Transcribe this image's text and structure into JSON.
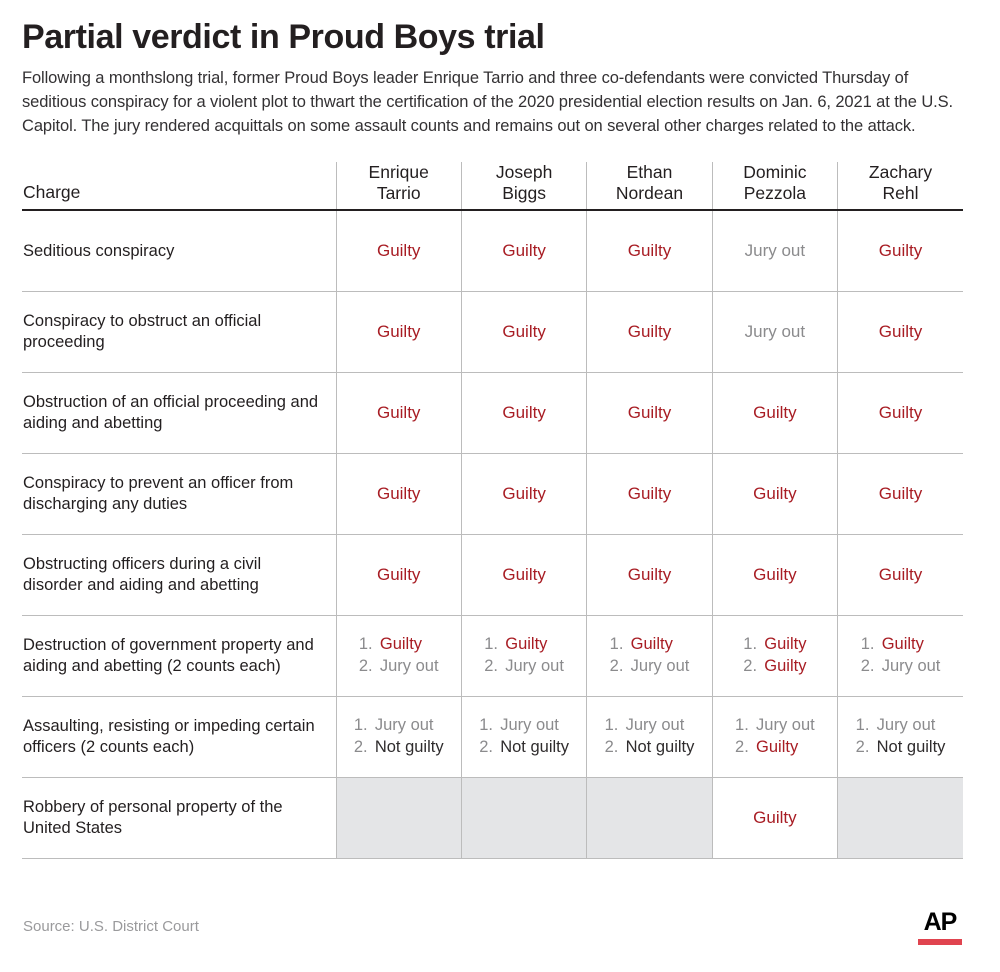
{
  "header": {
    "title": "Partial verdict in Proud Boys trial",
    "subtitle": "Following a monthslong trial, former Proud Boys leader Enrique Tarrio and three co-defendants were convicted Thursday of seditious conspiracy for a violent plot to thwart the certification of the 2020 presidential election results on Jan. 6, 2021 at the U.S. Capitol. The jury rendered acquittals on some assault counts and remains out on several other charges related to the attack."
  },
  "table": {
    "charge_header": "Charge",
    "defendants": [
      {
        "first": "Enrique",
        "last": "Tarrio"
      },
      {
        "first": "Joseph",
        "last": "Biggs"
      },
      {
        "first": "Ethan",
        "last": "Nordean"
      },
      {
        "first": "Dominic",
        "last": "Pezzola"
      },
      {
        "first": "Zachary",
        "last": "Rehl"
      }
    ],
    "rows": [
      {
        "charge": "Seditious conspiracy",
        "type": "single",
        "cells": [
          {
            "text": "Guilty",
            "status": "guilty"
          },
          {
            "text": "Guilty",
            "status": "guilty"
          },
          {
            "text": "Guilty",
            "status": "guilty"
          },
          {
            "text": "Jury out",
            "status": "juryout"
          },
          {
            "text": "Guilty",
            "status": "guilty"
          }
        ]
      },
      {
        "charge": "Conspiracy to obstruct an official proceeding",
        "type": "single",
        "cells": [
          {
            "text": "Guilty",
            "status": "guilty"
          },
          {
            "text": "Guilty",
            "status": "guilty"
          },
          {
            "text": "Guilty",
            "status": "guilty"
          },
          {
            "text": "Jury out",
            "status": "juryout"
          },
          {
            "text": "Guilty",
            "status": "guilty"
          }
        ]
      },
      {
        "charge": "Obstruction of an official proceeding and aiding and abetting",
        "type": "single",
        "cells": [
          {
            "text": "Guilty",
            "status": "guilty"
          },
          {
            "text": "Guilty",
            "status": "guilty"
          },
          {
            "text": "Guilty",
            "status": "guilty"
          },
          {
            "text": "Guilty",
            "status": "guilty"
          },
          {
            "text": "Guilty",
            "status": "guilty"
          }
        ]
      },
      {
        "charge": "Conspiracy to prevent an officer from discharging any duties",
        "type": "single",
        "cells": [
          {
            "text": "Guilty",
            "status": "guilty"
          },
          {
            "text": "Guilty",
            "status": "guilty"
          },
          {
            "text": "Guilty",
            "status": "guilty"
          },
          {
            "text": "Guilty",
            "status": "guilty"
          },
          {
            "text": "Guilty",
            "status": "guilty"
          }
        ]
      },
      {
        "charge": "Obstructing officers during a civil disorder and aiding and abetting",
        "type": "single",
        "cells": [
          {
            "text": "Guilty",
            "status": "guilty"
          },
          {
            "text": "Guilty",
            "status": "guilty"
          },
          {
            "text": "Guilty",
            "status": "guilty"
          },
          {
            "text": "Guilty",
            "status": "guilty"
          },
          {
            "text": "Guilty",
            "status": "guilty"
          }
        ]
      },
      {
        "charge": "Destruction of government property and aiding and abetting (2 counts each)",
        "type": "counts",
        "cells": [
          {
            "counts": [
              {
                "num": "1.",
                "text": "Guilty",
                "status": "guilty"
              },
              {
                "num": "2.",
                "text": "Jury out",
                "status": "juryout"
              }
            ]
          },
          {
            "counts": [
              {
                "num": "1.",
                "text": "Guilty",
                "status": "guilty"
              },
              {
                "num": "2.",
                "text": "Jury out",
                "status": "juryout"
              }
            ]
          },
          {
            "counts": [
              {
                "num": "1.",
                "text": "Guilty",
                "status": "guilty"
              },
              {
                "num": "2.",
                "text": "Jury out",
                "status": "juryout"
              }
            ]
          },
          {
            "counts": [
              {
                "num": "1.",
                "text": "Guilty",
                "status": "guilty"
              },
              {
                "num": "2.",
                "text": "Guilty",
                "status": "guilty"
              }
            ]
          },
          {
            "counts": [
              {
                "num": "1.",
                "text": "Guilty",
                "status": "guilty"
              },
              {
                "num": "2.",
                "text": "Jury out",
                "status": "juryout"
              }
            ]
          }
        ]
      },
      {
        "charge": "Assaulting, resisting or impeding certain officers (2 counts each)",
        "type": "counts",
        "cells": [
          {
            "counts": [
              {
                "num": "1.",
                "text": "Jury out",
                "status": "juryout"
              },
              {
                "num": "2.",
                "text": "Not guilty",
                "status": "notguilty"
              }
            ]
          },
          {
            "counts": [
              {
                "num": "1.",
                "text": "Jury out",
                "status": "juryout"
              },
              {
                "num": "2.",
                "text": "Not guilty",
                "status": "notguilty"
              }
            ]
          },
          {
            "counts": [
              {
                "num": "1.",
                "text": "Jury out",
                "status": "juryout"
              },
              {
                "num": "2.",
                "text": "Not guilty",
                "status": "notguilty"
              }
            ]
          },
          {
            "counts": [
              {
                "num": "1.",
                "text": "Jury out",
                "status": "juryout"
              },
              {
                "num": "2.",
                "text": "Guilty",
                "status": "guilty"
              }
            ]
          },
          {
            "counts": [
              {
                "num": "1.",
                "text": "Jury out",
                "status": "juryout"
              },
              {
                "num": "2.",
                "text": "Not guilty",
                "status": "notguilty"
              }
            ]
          }
        ]
      },
      {
        "charge": "Robbery of personal property of the United States",
        "type": "single",
        "cells": [
          {
            "text": "",
            "status": "empty"
          },
          {
            "text": "",
            "status": "empty"
          },
          {
            "text": "",
            "status": "empty"
          },
          {
            "text": "Guilty",
            "status": "guilty"
          },
          {
            "text": "",
            "status": "empty"
          }
        ]
      }
    ]
  },
  "footer": {
    "source": "Source: U.S. District Court",
    "logo_text": "AP"
  },
  "colors": {
    "guilty": "#a81d24",
    "jury_out": "#8b8b8d",
    "not_guilty": "#2f2c2d",
    "empty_cell": "#e4e5e7",
    "ap_red": "#e0444f",
    "rule": "#bcbcbc",
    "header_rule": "#231f20"
  }
}
